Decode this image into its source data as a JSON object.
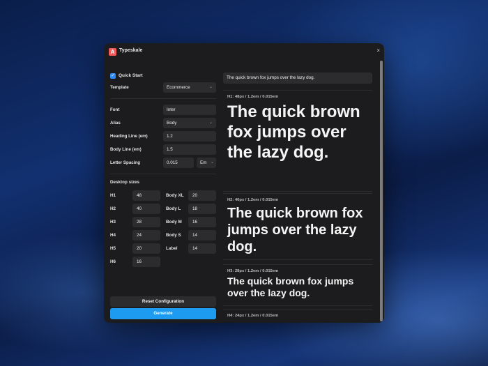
{
  "app": {
    "title": "Typeskale",
    "logo_letter": "A",
    "close_glyph": "×"
  },
  "sidebar": {
    "quick_start": {
      "label": "Quick Start",
      "checked": true,
      "check_glyph": "✓"
    },
    "template": {
      "label": "Template",
      "value": "Ecommerce"
    },
    "font": {
      "label": "Font",
      "value": "Inter"
    },
    "alias": {
      "label": "Alias",
      "value": "Body"
    },
    "heading_line": {
      "label": "Heading Line (em)",
      "value": "1.2"
    },
    "body_line": {
      "label": "Body Line (em)",
      "value": "1.5"
    },
    "letter_spacing": {
      "label": "Letter Spacing",
      "value": "0.015",
      "unit": "Em"
    },
    "chevron_glyph": "⌄",
    "desktop_sizes": {
      "title": "Desktop sizes",
      "headings": [
        {
          "label": "H1",
          "value": "48"
        },
        {
          "label": "H2",
          "value": "40"
        },
        {
          "label": "H3",
          "value": "28"
        },
        {
          "label": "H4",
          "value": "24"
        },
        {
          "label": "H5",
          "value": "20"
        },
        {
          "label": "H6",
          "value": "16"
        }
      ],
      "body": [
        {
          "label": "Body XL",
          "value": "20"
        },
        {
          "label": "Body L",
          "value": "18"
        },
        {
          "label": "Body M",
          "value": "16"
        },
        {
          "label": "Body S",
          "value": "14"
        },
        {
          "label": "Label",
          "value": "14"
        }
      ]
    },
    "reset_label": "Reset Configuration",
    "generate_label": "Generate"
  },
  "preview": {
    "sample_text": "The quick brown fox jumps over the lazy dog.",
    "items": [
      {
        "meta": "H1: 48px / 1.2em / 0.015em",
        "text": "The quick brown fox jumps over the lazy dog."
      },
      {
        "meta": "H2: 40px / 1.2em / 0.015em",
        "text": "The quick brown fox jumps over the lazy dog."
      },
      {
        "meta": "H3: 28px / 1.2em / 0.015em",
        "text": "The quick brown fox jumps over the lazy dog."
      },
      {
        "meta": "H4: 24px / 1.2em / 0.015em",
        "text": ""
      }
    ]
  },
  "colors": {
    "accent": "#1d9bf0",
    "checkbox": "#2a8af6",
    "logo": "#f05a5a",
    "window_bg": "#1c1c1e"
  }
}
